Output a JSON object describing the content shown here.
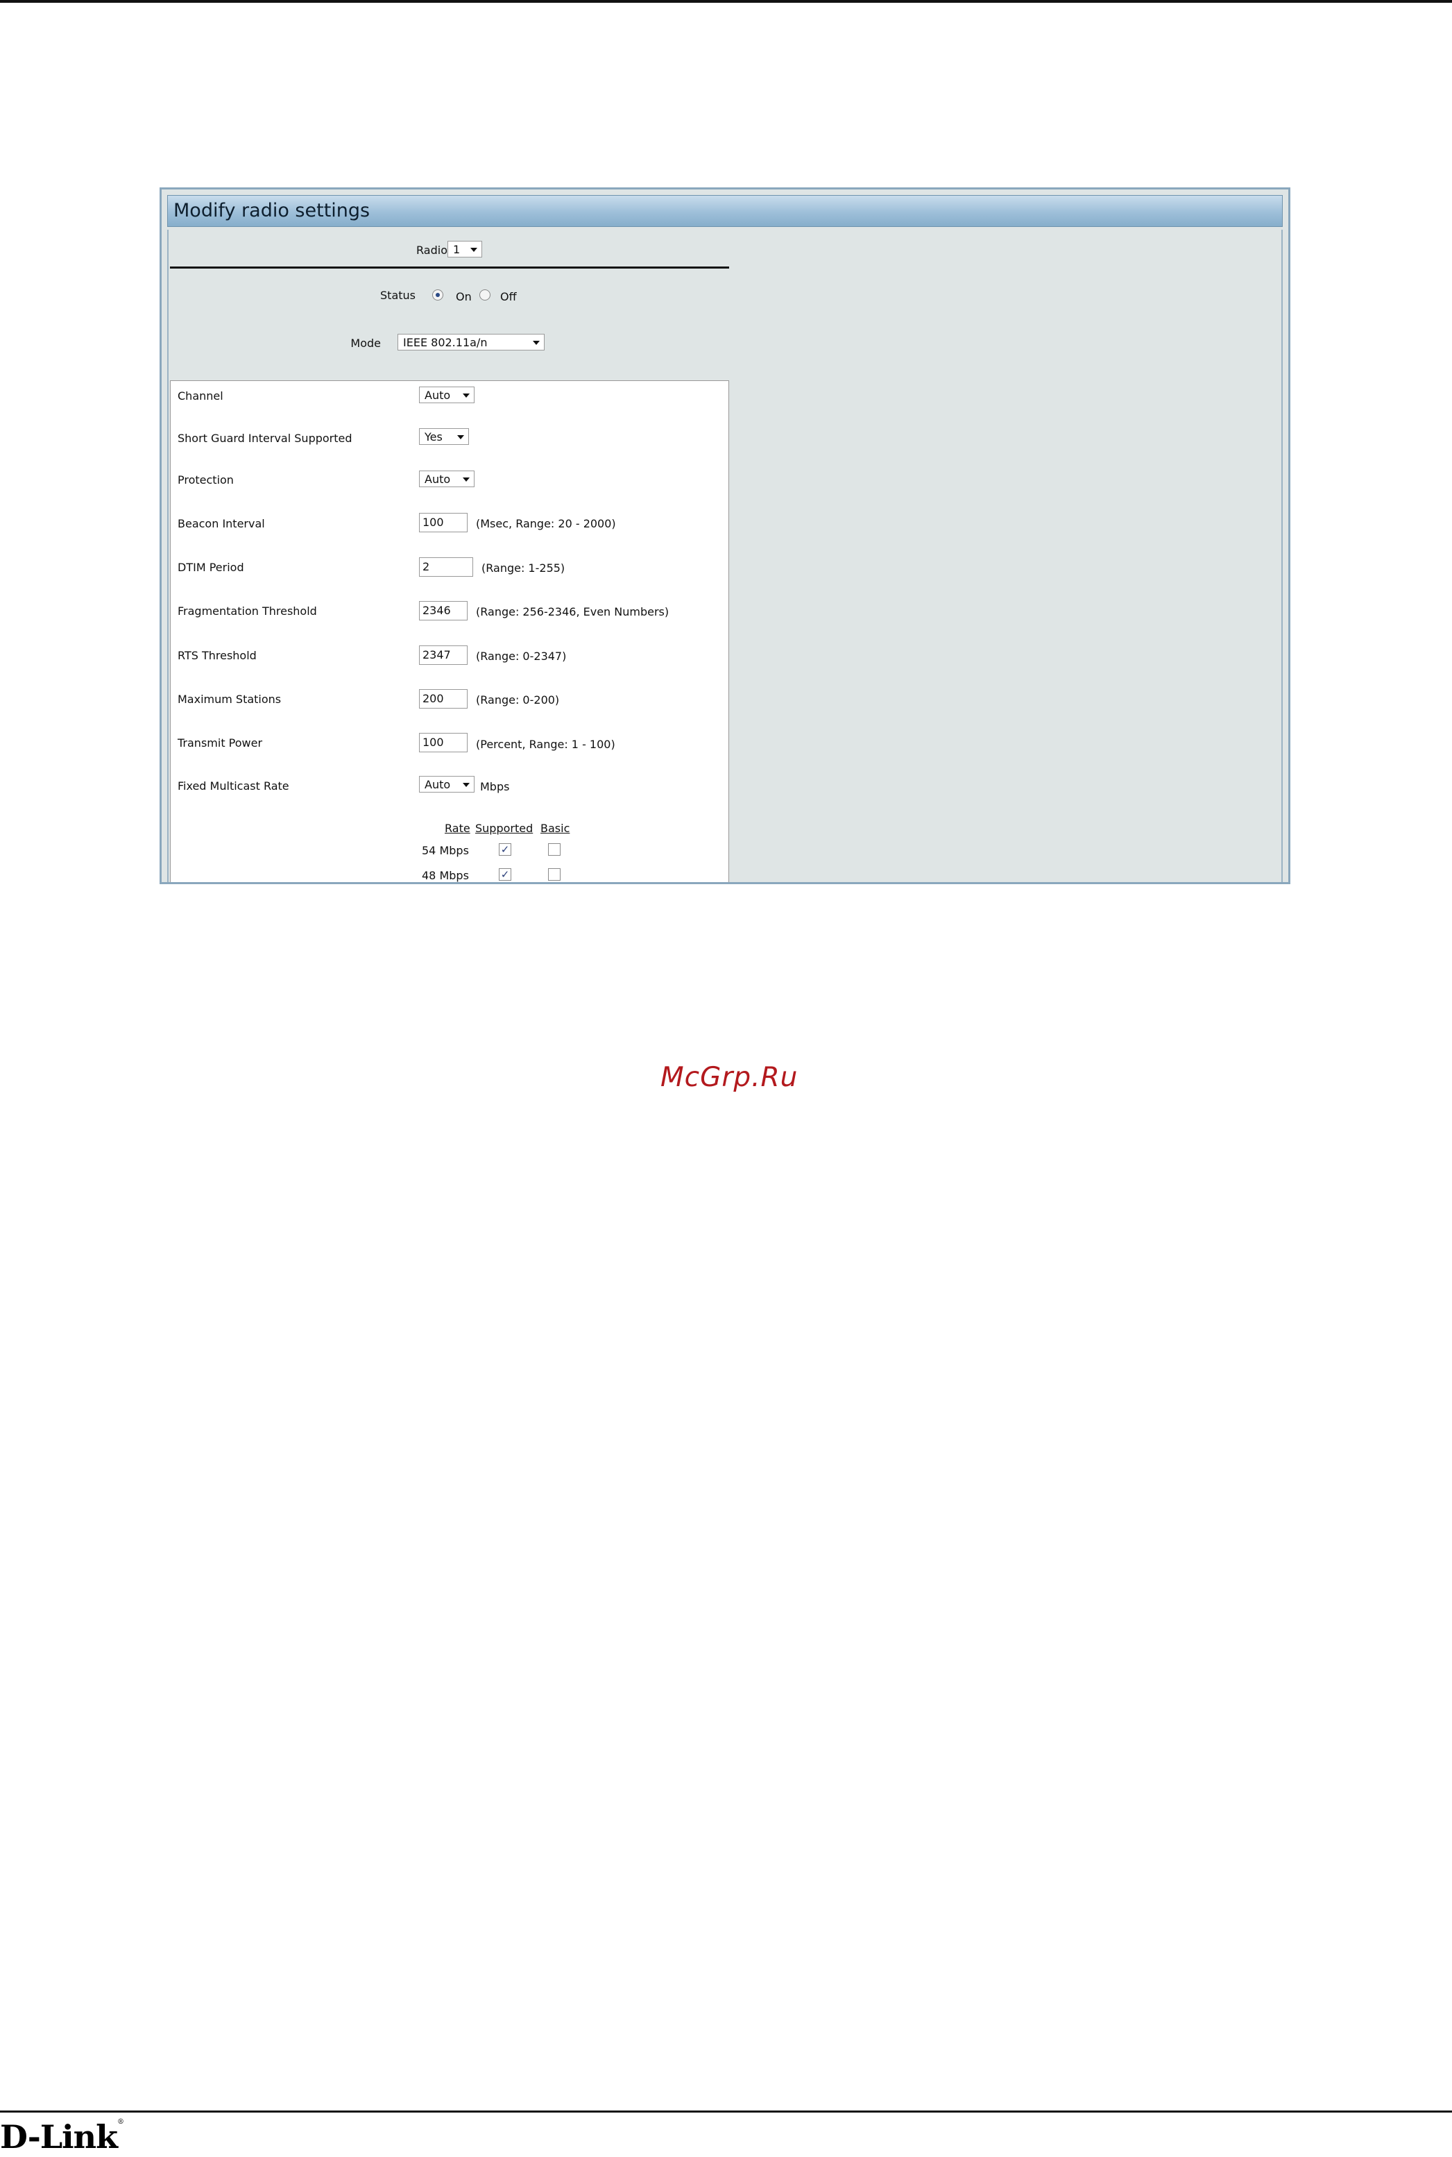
{
  "panel": {
    "title": "Modify radio settings"
  },
  "radio": {
    "label": "Radio",
    "value": "1"
  },
  "status": {
    "label": "Status",
    "on_label": "On",
    "off_label": "Off",
    "selected": "On"
  },
  "mode": {
    "label": "Mode",
    "value": "IEEE 802.11a/n"
  },
  "settings": {
    "channel": {
      "label": "Channel",
      "value": "Auto"
    },
    "short_guard": {
      "label": "Short Guard Interval Supported",
      "value": "Yes"
    },
    "protection": {
      "label": "Protection",
      "value": "Auto"
    },
    "beacon_interval": {
      "label": "Beacon Interval",
      "value": "100",
      "hint": "(Msec, Range: 20 - 2000)"
    },
    "dtim_period": {
      "label": "DTIM Period",
      "value": "2",
      "hint": "(Range: 1-255)"
    },
    "fragmentation": {
      "label": "Fragmentation Threshold",
      "value": "2346",
      "hint": "(Range: 256-2346, Even Numbers)"
    },
    "rts_threshold": {
      "label": "RTS Threshold",
      "value": "2347",
      "hint": "(Range: 0-2347)"
    },
    "max_stations": {
      "label": "Maximum Stations",
      "value": "200",
      "hint": "(Range: 0-200)"
    },
    "transmit_power": {
      "label": "Transmit Power",
      "value": "100",
      "hint": "(Percent, Range: 1 - 100)"
    },
    "fixed_multicast": {
      "label": "Fixed Multicast Rate",
      "value": "Auto",
      "unit": "Mbps"
    }
  },
  "rate_table": {
    "headers": {
      "rate": "Rate",
      "supported": "Supported",
      "basic": "Basic"
    },
    "rows": [
      {
        "rate": "54 Mbps",
        "supported": true,
        "basic": false
      },
      {
        "rate": "48 Mbps",
        "supported": true,
        "basic": false
      }
    ]
  },
  "watermark": "McGrp.Ru",
  "footer": {
    "brand": "D-Link",
    "registered": "®"
  }
}
